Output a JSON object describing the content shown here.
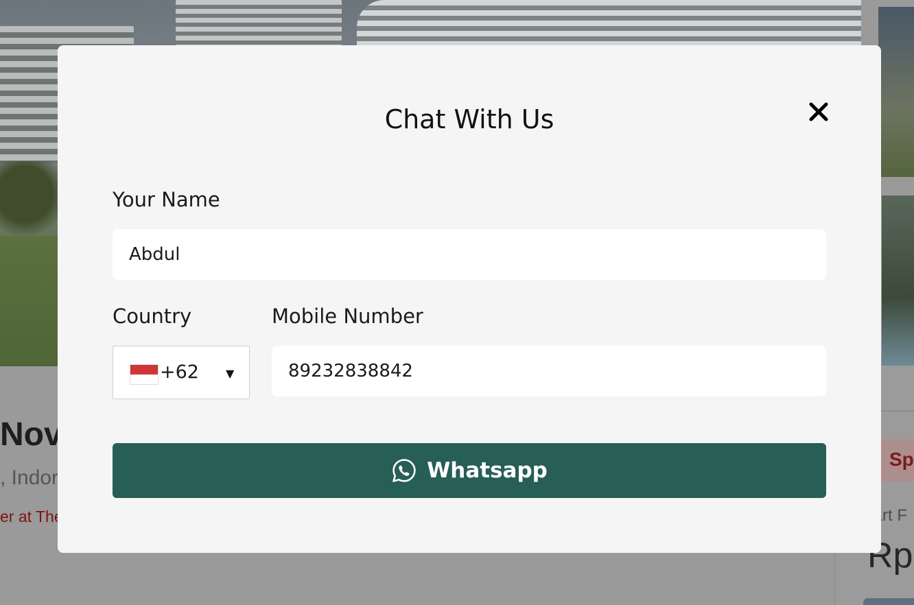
{
  "background": {
    "listing_title": "Nov",
    "listing_location": ", Indor",
    "listing_promo": "er at The",
    "side_badge": "Sp",
    "side_start_label": "tart F",
    "side_price": "Rp"
  },
  "modal": {
    "title": "Chat With Us",
    "close_icon": "close-icon",
    "name_label": "Your Name",
    "name_value": "Abdul",
    "country_label": "Country",
    "country_flag": "indonesia-flag",
    "country_code": "+62",
    "mobile_label": "Mobile Number",
    "mobile_value": "89232838842",
    "submit_label": "Whatsapp",
    "submit_icon": "whatsapp-icon",
    "submit_color": "#275e55"
  }
}
